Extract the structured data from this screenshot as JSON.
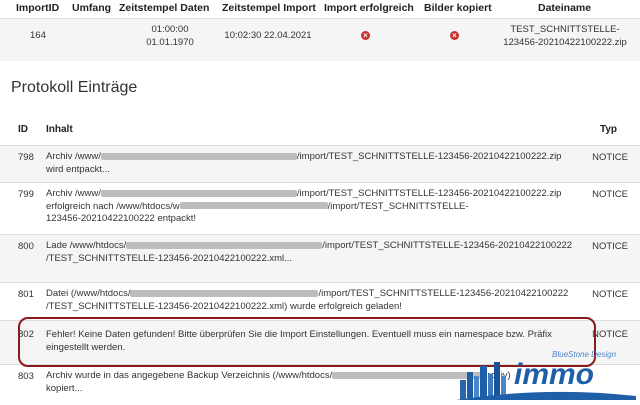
{
  "import_table": {
    "headers": [
      "ImportID",
      "Umfang",
      "Zeitstempel Daten",
      "Zeitstempel Import",
      "Import erfolgreich",
      "Bilder kopiert",
      "Dateiname"
    ],
    "row": {
      "id": "164",
      "umfang": "",
      "zeit_daten_1": "01:00:00",
      "zeit_daten_2": "01.01.1970",
      "zeit_import": "10:02:30 22.04.2021",
      "dateiname_1": "TEST_SCHNITTSTELLE-",
      "dateiname_2": "123456-20210422100222.zip"
    },
    "status_icon": "x-circle-icon"
  },
  "protocol": {
    "title": "Protokoll Einträge",
    "headers": {
      "id": "ID",
      "inhalt": "Inhalt",
      "typ": "Typ"
    },
    "rows": [
      {
        "id": "798",
        "line1_a": "Archiv /www/",
        "line1_b": "/import/TEST_SCHNITTSTELLE-123456-20210422100222.zip",
        "line2": "wird entpackt...",
        "type": "NOTICE"
      },
      {
        "id": "799",
        "line1_a": "Archiv /www/",
        "line1_b": "/import/TEST_SCHNITTSTELLE-123456-20210422100222.zip",
        "line2_a": "erfolgreich nach /www/htdocs/w",
        "line2_b": "/import/TEST_SCHNITTSTELLE-",
        "line3": "123456-20210422100222 entpackt!",
        "type": "NOTICE"
      },
      {
        "id": "800",
        "line1_a": "Lade /www/htdocs/",
        "line1_b": "/import/TEST_SCHNITTSTELLE-123456-20210422100222",
        "line2": "/TEST_SCHNITTSTELLE-123456-20210422100222.xml...",
        "type": "NOTICE"
      },
      {
        "id": "801",
        "line1_a": "Datei (/www/htdocs/",
        "line1_b": "/import/TEST_SCHNITTSTELLE-123456-20210422100222",
        "line2": "/TEST_SCHNITTSTELLE-123456-20210422100222.xml) wurde erfolgreich geladen!",
        "type": "NOTICE"
      },
      {
        "id": "802",
        "line1": "Fehler! Keine Daten gefunden! Bitte überprüfen Sie die Import Einstellungen. Eventuell muss ein namespace bzw. Präfix",
        "line2": "eingestellt werden.",
        "type": "NOTICE"
      },
      {
        "id": "803",
        "line1_a": "Archiv wurde in das angegebene Backup Verzeichnis (/www/htdocs/",
        "line1_b": "archiv)",
        "line2": "kopiert...",
        "type": ""
      }
    ]
  },
  "logo": {
    "text": "immo",
    "tagline": "BlueStone Design"
  },
  "colors": {
    "highlight": "#8b1a1a",
    "error_icon": "#c9302c",
    "logo_blue": "#1f5fa8"
  }
}
